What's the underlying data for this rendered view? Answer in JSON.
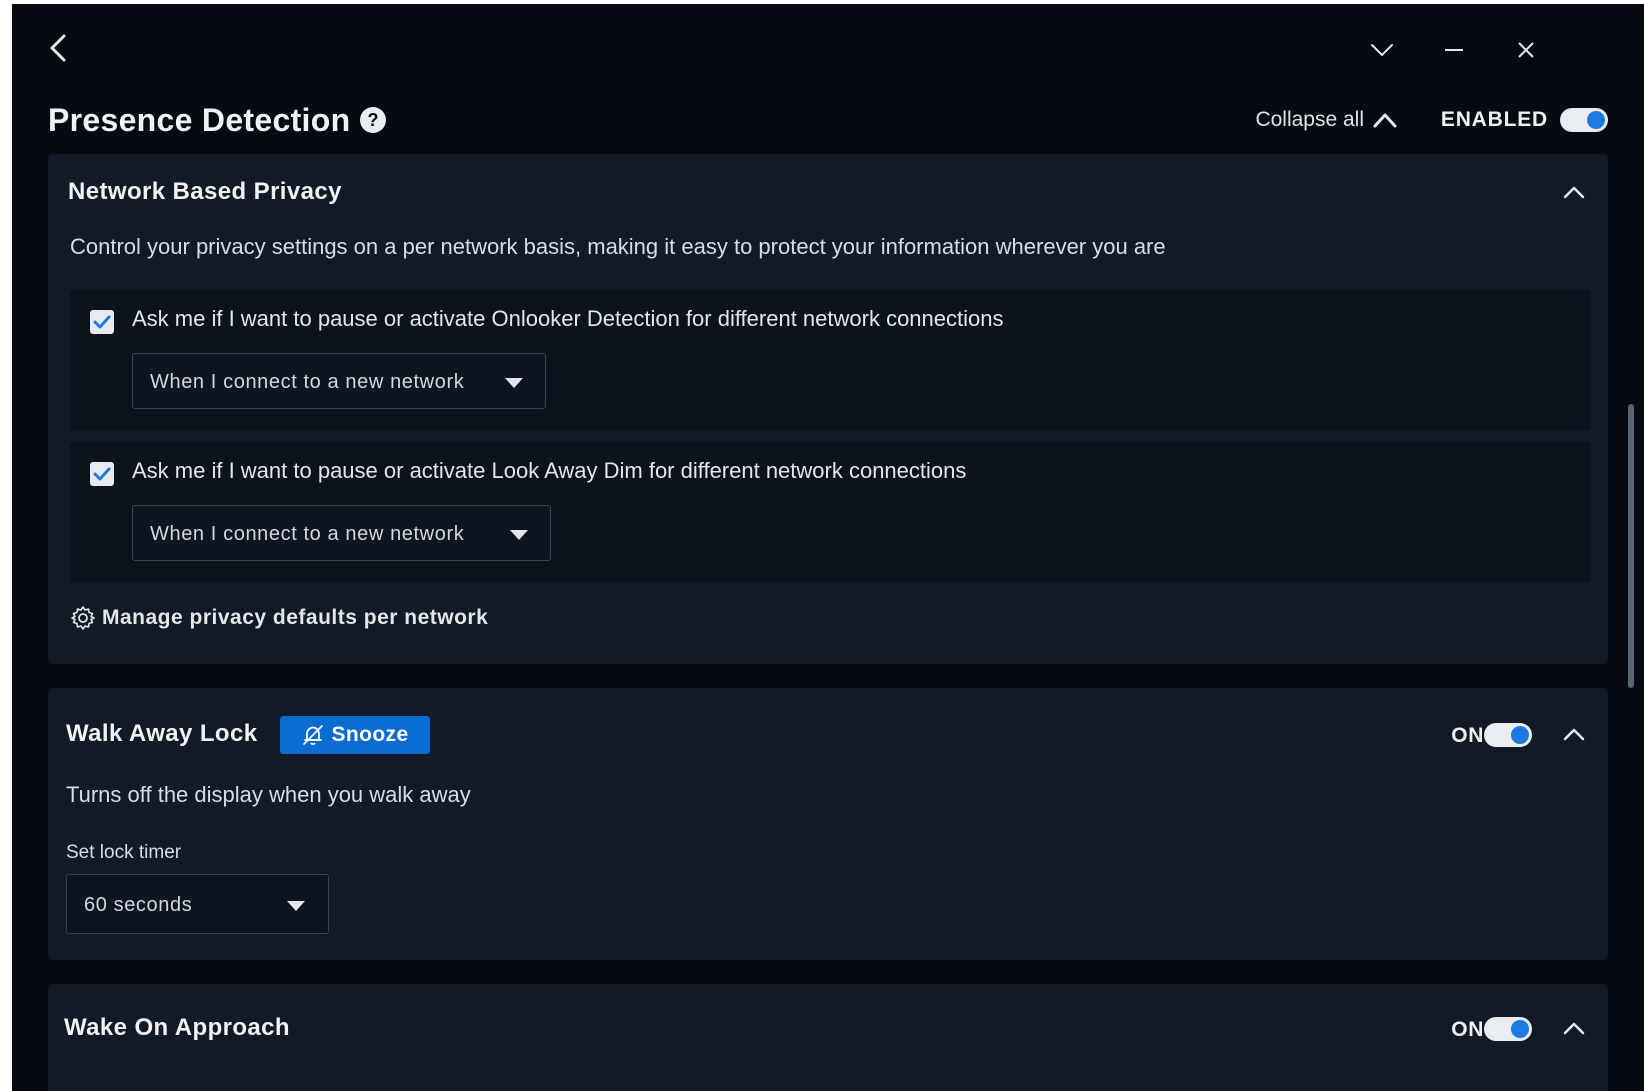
{
  "window": {
    "title": "Presence Detection",
    "enabled_label": "ENABLED",
    "collapse_all_label": "Collapse all",
    "help_glyph": "?",
    "enabled": true
  },
  "icons": {
    "back": "back-arrow-icon",
    "minimize_menu": "chevron-down-icon",
    "minimize": "minimize-icon",
    "close": "close-icon"
  },
  "network_privacy": {
    "title": "Network Based Privacy",
    "description": "Control your privacy settings on a per network basis, making it easy to protect your information wherever you are",
    "options": [
      {
        "label": "Ask me if I want to pause or activate Onlooker Detection for different network connections",
        "checked": true,
        "dropdown_value": "When I connect to a new network"
      },
      {
        "label": "Ask me if I want to pause or activate Look Away Dim for different network connections",
        "checked": true,
        "dropdown_value": "When I connect to a new network"
      }
    ],
    "manage_link": "Manage privacy defaults per network"
  },
  "walk_away_lock": {
    "title": "Walk Away Lock",
    "snooze_label": "Snooze",
    "state_label": "ON",
    "on": true,
    "description": "Turns off the display when you walk away",
    "timer_label": "Set lock timer",
    "timer_value": "60 seconds"
  },
  "wake_on_approach": {
    "title": "Wake On Approach",
    "state_label": "ON",
    "on": true
  },
  "colors": {
    "background": "#070b11",
    "card": "#111a26",
    "accent": "#1e7ae0",
    "snooze": "#0a6bd1"
  }
}
